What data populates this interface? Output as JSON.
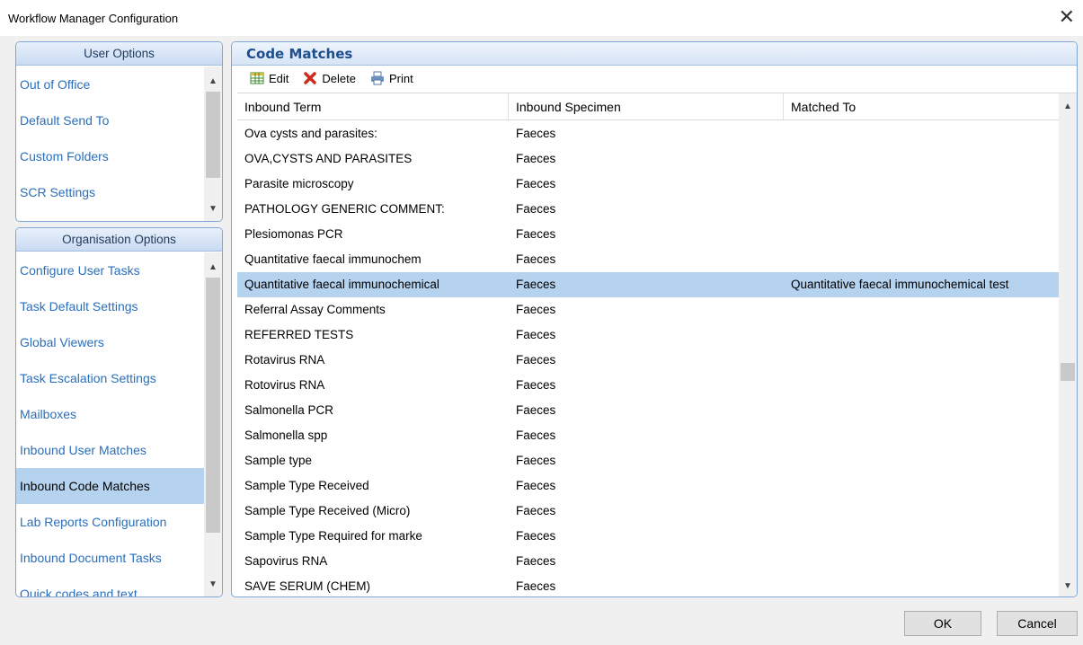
{
  "window": {
    "title": "Workflow Manager Configuration",
    "close_glyph": "✕"
  },
  "user_options": {
    "header": "User Options",
    "items": [
      "Out of Office",
      "Default Send To",
      "Custom Folders",
      "SCR Settings"
    ]
  },
  "org_options": {
    "header": "Organisation Options",
    "items": [
      "Configure User Tasks",
      "Task Default Settings",
      "Global Viewers",
      "Task Escalation Settings",
      "Mailboxes",
      "Inbound User Matches",
      "Inbound Code Matches",
      "Lab Reports Configuration",
      "Inbound Document Tasks",
      "Quick codes and text"
    ],
    "selected_index": 6
  },
  "main": {
    "title": "Code Matches",
    "toolbar": {
      "edit": "Edit",
      "delete": "Delete",
      "print": "Print"
    },
    "columns": [
      "Inbound Term",
      "Inbound Specimen",
      "Matched To"
    ],
    "rows": [
      [
        "Ova cysts and parasites:",
        "Faeces",
        ""
      ],
      [
        "OVA,CYSTS AND PARASITES",
        "Faeces",
        ""
      ],
      [
        "Parasite microscopy",
        "Faeces",
        ""
      ],
      [
        "PATHOLOGY GENERIC COMMENT:",
        "Faeces",
        ""
      ],
      [
        "Plesiomonas PCR",
        "Faeces",
        ""
      ],
      [
        "Quantitative faecal immunochem",
        "Faeces",
        ""
      ],
      [
        "Quantitative faecal immunochemical",
        "Faeces",
        "Quantitative faecal immunochemical test"
      ],
      [
        "Referral Assay Comments",
        "Faeces",
        ""
      ],
      [
        "REFERRED TESTS",
        "Faeces",
        ""
      ],
      [
        "Rotavirus RNA",
        "Faeces",
        ""
      ],
      [
        "Rotovirus RNA",
        "Faeces",
        ""
      ],
      [
        "Salmonella PCR",
        "Faeces",
        ""
      ],
      [
        "Salmonella spp",
        "Faeces",
        ""
      ],
      [
        "Sample type",
        "Faeces",
        ""
      ],
      [
        "Sample Type Received",
        "Faeces",
        ""
      ],
      [
        "Sample Type Received (Micro)",
        "Faeces",
        ""
      ],
      [
        "Sample Type Required for marke",
        "Faeces",
        ""
      ],
      [
        "Sapovirus RNA",
        "Faeces",
        ""
      ],
      [
        "SAVE SERUM (CHEM)",
        "Faeces",
        ""
      ]
    ],
    "selected_row": 6
  },
  "buttons": {
    "ok": "OK",
    "cancel": "Cancel"
  },
  "icons": {
    "edit": "grid-edit-icon",
    "delete": "red-x-icon",
    "print": "printer-icon"
  },
  "colors": {
    "accent_border": "#7fa6d6",
    "link": "#2a6ebb",
    "selection": "#b5d2ee",
    "header_text": "#1e4e8c"
  }
}
